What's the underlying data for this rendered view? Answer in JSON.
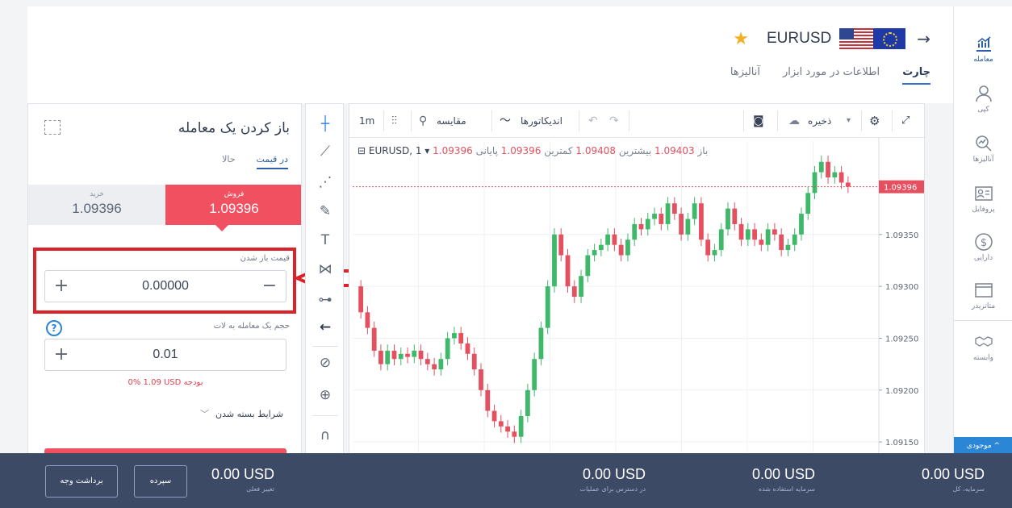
{
  "header": {
    "symbol": "EURUSD",
    "tabs": [
      {
        "label": "چارت",
        "active": true
      },
      {
        "label": "اطلاعات در مورد ابزار",
        "active": false
      },
      {
        "label": "آنالیزها",
        "active": false
      }
    ]
  },
  "sidebar": {
    "items": [
      {
        "label": "معامله",
        "icon": "chart-icon",
        "active": true
      },
      {
        "label": "کپی",
        "icon": "copy-user-icon",
        "active": false
      },
      {
        "label": "آنالیزها",
        "icon": "analysis-icon",
        "active": false
      },
      {
        "label": "پروفایل",
        "icon": "profile-icon",
        "active": false
      },
      {
        "label": "دارایی",
        "icon": "dollar-icon",
        "active": false
      },
      {
        "label": "متاتریدر",
        "icon": "window-icon",
        "active": false
      },
      {
        "label": "وابسته",
        "icon": "handshake-icon",
        "active": false
      }
    ],
    "bottom_label": "موجودی ^"
  },
  "order_panel": {
    "title": "باز کردن یک معامله",
    "mode_tabs": [
      {
        "label": "در قیمت",
        "active": true
      },
      {
        "label": "حالا",
        "active": false
      }
    ],
    "sell": {
      "label": "فروش",
      "price": "1.09396"
    },
    "buy": {
      "label": "خرید",
      "price": "1.09396"
    },
    "open_price_label": "قیمت باز شدن",
    "open_price_value": "0.00000",
    "lot_label": "حجم یک معامله به لات",
    "lot_value": "0.01",
    "help_symbol": "?",
    "margin_text": "0%   1.09 USD بودجه",
    "close_conditions": "شرایط بسته شدن",
    "plus": "+",
    "minus": "−"
  },
  "chart_toolbar": {
    "timeframe": "1m",
    "compare": "مقایسه",
    "indicators": "اندیکاتورها",
    "save": "ذخیره",
    "undo": "↶",
    "redo": "↷"
  },
  "chart_data": {
    "type": "candlestick",
    "symbol_legend": "EURUSD, 1",
    "legend": {
      "open_label": "باز",
      "open": "1.09403",
      "high_label": "بیشترین",
      "high": "1.09408",
      "low_label": "کمترین",
      "low": "1.09396",
      "close_label": "پایانی",
      "close": "1.09396"
    },
    "current_price": "1.09396",
    "y_ticks": [
      "1.09350",
      "1.09300",
      "1.09250",
      "1.09200",
      "1.09150"
    ],
    "ylim": [
      1.0914,
      1.0944
    ],
    "up_color": "#3fb86a",
    "down_color": "#e4505f",
    "close": [
      1.09275,
      1.0926,
      1.09238,
      1.09225,
      1.09238,
      1.0923,
      1.09235,
      1.09232,
      1.09238,
      1.0923,
      1.09225,
      1.0922,
      1.0923,
      1.0925,
      1.09255,
      1.09245,
      1.09235,
      1.0922,
      1.092,
      1.0918,
      1.0917,
      1.09165,
      1.0916,
      1.09155,
      1.09175,
      1.092,
      1.0923,
      1.0926,
      1.093,
      1.0935,
      1.0933,
      1.093,
      1.0929,
      1.0931,
      1.0933,
      1.09335,
      1.0934,
      1.0935,
      1.0934,
      1.0933,
      1.09345,
      1.0936,
      1.09355,
      1.09365,
      1.0937,
      1.0936,
      1.0938,
      1.0937,
      1.0935,
      1.09365,
      1.0938,
      1.09345,
      1.0933,
      1.09335,
      1.09355,
      1.09375,
      1.0936,
      1.09345,
      1.09355,
      1.09345,
      1.0934,
      1.09355,
      1.0935,
      1.09335,
      1.0934,
      1.0935,
      1.0937,
      1.0939,
      1.0941,
      1.0942,
      1.09405,
      1.0941,
      1.094,
      1.09396
    ],
    "open_first": 1.093
  },
  "bottom_bar": {
    "withdraw": "برداشت وجه",
    "deposit": "سپرده",
    "stats": [
      {
        "value": "0.00 USD",
        "label": "تغییر فعلی"
      },
      {
        "value": "0.00 USD",
        "label": "در دسترس برای عملیات"
      },
      {
        "value": "0.00 USD",
        "label": "سرمایه استفاده شده"
      },
      {
        "value": "0.00 USD",
        "label": "سرمایه، کل"
      }
    ]
  }
}
